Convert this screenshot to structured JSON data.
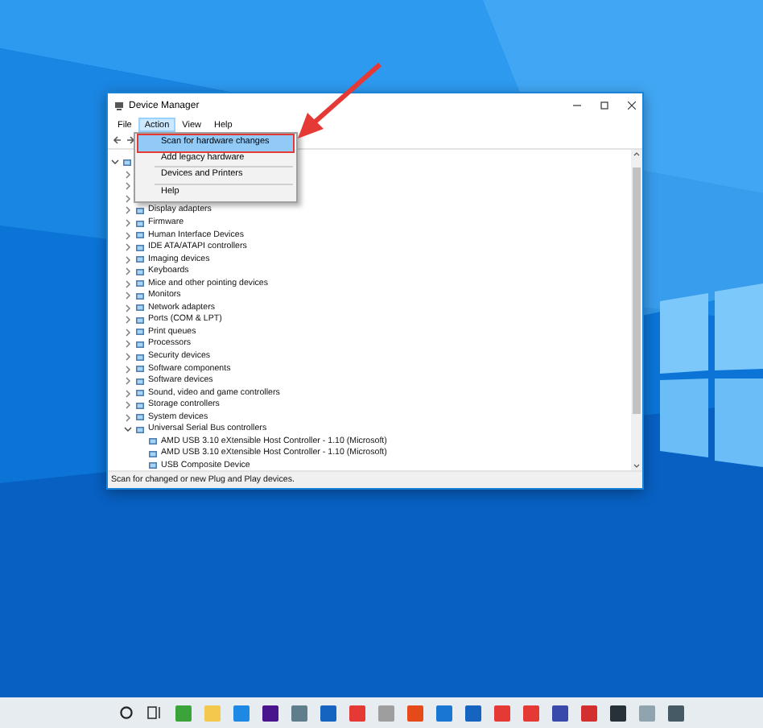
{
  "window": {
    "title": "Device Manager"
  },
  "menu_bar": [
    {
      "label": "File",
      "selected": false
    },
    {
      "label": "Action",
      "selected": true
    },
    {
      "label": "View",
      "selected": false
    },
    {
      "label": "Help",
      "selected": false
    }
  ],
  "action_menu": [
    {
      "label": "Scan for hardware changes",
      "selected": true
    },
    {
      "label": "Add legacy hardware",
      "selected": false
    },
    {
      "kind": "separator"
    },
    {
      "label": "Devices and Printers",
      "selected": false
    },
    {
      "kind": "separator"
    },
    {
      "label": "Help",
      "selected": false
    }
  ],
  "tree": [
    {
      "expanded": true,
      "children": [
        {
          "expanded": false
        },
        {
          "expanded": false
        },
        {
          "expanded": false
        },
        {
          "label": "Display adapters",
          "expanded": false
        },
        {
          "label": "Firmware",
          "expanded": false
        },
        {
          "label": "Human Interface Devices",
          "expanded": false
        },
        {
          "label": "IDE ATA/ATAPI controllers",
          "expanded": false
        },
        {
          "label": "Imaging devices",
          "expanded": false
        },
        {
          "label": "Keyboards",
          "expanded": false
        },
        {
          "label": "Mice and other pointing devices",
          "expanded": false
        },
        {
          "label": "Monitors",
          "expanded": false
        },
        {
          "label": "Network adapters",
          "expanded": false
        },
        {
          "label": "Ports (COM & LPT)",
          "expanded": false
        },
        {
          "label": "Print queues",
          "expanded": false
        },
        {
          "label": "Processors",
          "expanded": false
        },
        {
          "label": "Security devices",
          "expanded": false
        },
        {
          "label": "Software components",
          "expanded": false
        },
        {
          "label": "Software devices",
          "expanded": false
        },
        {
          "label": "Sound, video and game controllers",
          "expanded": false
        },
        {
          "label": "Storage controllers",
          "expanded": false
        },
        {
          "label": "System devices",
          "expanded": false
        },
        {
          "label": "Universal Serial Bus controllers",
          "expanded": true,
          "children": [
            {
              "label": "AMD USB 3.10 eXtensible Host Controller - 1.10 (Microsoft)"
            },
            {
              "label": "AMD USB 3.10 eXtensible Host Controller - 1.10 (Microsoft)"
            },
            {
              "label": "USB Composite Device"
            }
          ]
        }
      ]
    }
  ],
  "status_bar": "Scan for changed or new Plug and Play devices."
}
